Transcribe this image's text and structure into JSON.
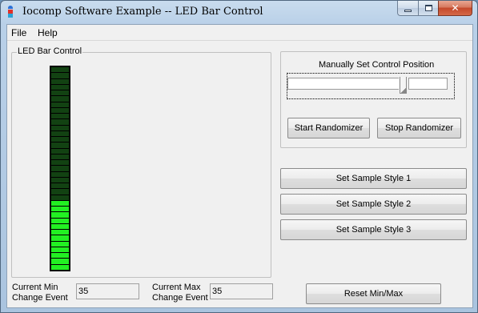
{
  "window": {
    "title": "Iocomp Software Example -- LED Bar Control"
  },
  "menu": {
    "items": [
      "File",
      "Help"
    ]
  },
  "led_group": {
    "label": "LED Bar Control",
    "segment_count": 35,
    "lit_fraction": 0.35,
    "color_on": "#22f022",
    "color_off": "#124212"
  },
  "manual_group": {
    "label": "Manually Set Control Position",
    "slider_position_fraction": 0.7,
    "start_label": "Start Randomizer",
    "stop_label": "Stop Randomizer"
  },
  "style_buttons": [
    "Set Sample Style 1",
    "Set Sample Style 2",
    "Set Sample Style 3"
  ],
  "min_field": {
    "label_line1": "Current Min",
    "label_line2": "Change Event",
    "value": "35"
  },
  "max_field": {
    "label_line1": "Current Max",
    "label_line2": "Change Event",
    "value": "35"
  },
  "reset_label": "Reset Min/Max"
}
